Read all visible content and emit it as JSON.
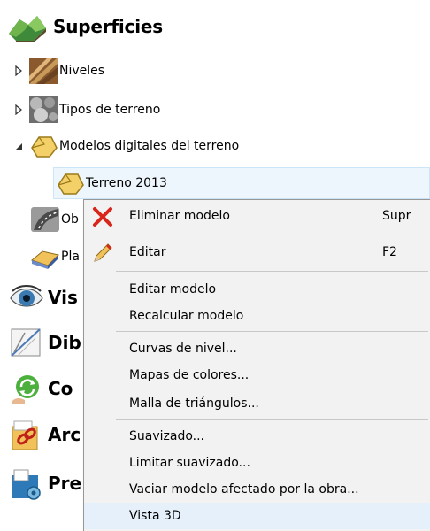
{
  "header": {
    "title": "Superficies",
    "icon": "terrain-icon"
  },
  "tree": {
    "items": [
      {
        "label": "Niveles",
        "icon": "levels-icon",
        "expanded": false
      },
      {
        "label": "Tipos de terreno",
        "icon": "terrain-types-icon",
        "expanded": false
      },
      {
        "label": "Modelos digitales del terreno",
        "icon": "dtm-icon",
        "expanded": true
      },
      {
        "label": "Terreno 2013",
        "icon": "dtm-icon",
        "selected": true
      },
      {
        "label": "Ob",
        "icon": "road-icon"
      },
      {
        "label": "Pla",
        "icon": "platform-icon"
      }
    ]
  },
  "sections": [
    {
      "label": "Vis",
      "icon": "eye-icon"
    },
    {
      "label": "Dib",
      "icon": "drawing-icon"
    },
    {
      "label": "Co",
      "icon": "refresh-icon"
    },
    {
      "label": "Arc",
      "icon": "link-icon"
    },
    {
      "label": "Pre",
      "icon": "budget-icon"
    }
  ],
  "context_menu": {
    "items": [
      {
        "label": "Eliminar modelo",
        "shortcut": "Supr",
        "icon": "delete-x-icon"
      },
      {
        "label": "Editar",
        "shortcut": "F2",
        "icon": "pencil-icon"
      },
      {
        "label": "Editar modelo"
      },
      {
        "label": "Recalcular modelo"
      },
      {
        "label": "Curvas de nivel..."
      },
      {
        "label": "Mapas de colores..."
      },
      {
        "label": "Malla de triángulos..."
      },
      {
        "label": "Suavizado..."
      },
      {
        "label": "Limitar suavizado..."
      },
      {
        "label": "Vaciar modelo afectado por la obra..."
      },
      {
        "label": "Vista 3D",
        "hovered": true
      }
    ]
  },
  "colors": {
    "selection_bg": "#eef6fd",
    "menu_bg": "#f2f2f2",
    "hover_bg": "#e5f0fb",
    "delete_red": "#d9261c"
  }
}
